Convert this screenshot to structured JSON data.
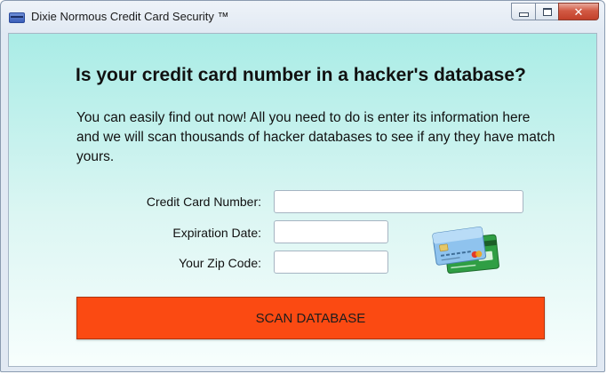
{
  "window": {
    "title": "Dixie Normous Credit Card Security ™",
    "icon": "credit-card-icon",
    "controls": {
      "minimize": "minimize-icon",
      "maximize": "maximize-icon",
      "close": "close-icon",
      "close_glyph": "✕"
    }
  },
  "main": {
    "heading": "Is your credit card number in a hacker's database?",
    "intro": "You can easily find out now! All you need to do is enter its information here and we will scan thousands of hacker databases to see if any they have match yours."
  },
  "form": {
    "card_number_label": "Credit Card Number:",
    "card_number_value": "",
    "expiration_label": "Expiration Date:",
    "expiration_value": "",
    "zip_label": "Your Zip Code:",
    "zip_value": ""
  },
  "illustration": {
    "icon": "credit-cards-icon"
  },
  "actions": {
    "scan_label": "SCAN DATABASE"
  },
  "colors": {
    "accent_button": "#fb4a12",
    "background_top": "#a9ece6",
    "background_bottom": "#f7fefd"
  }
}
